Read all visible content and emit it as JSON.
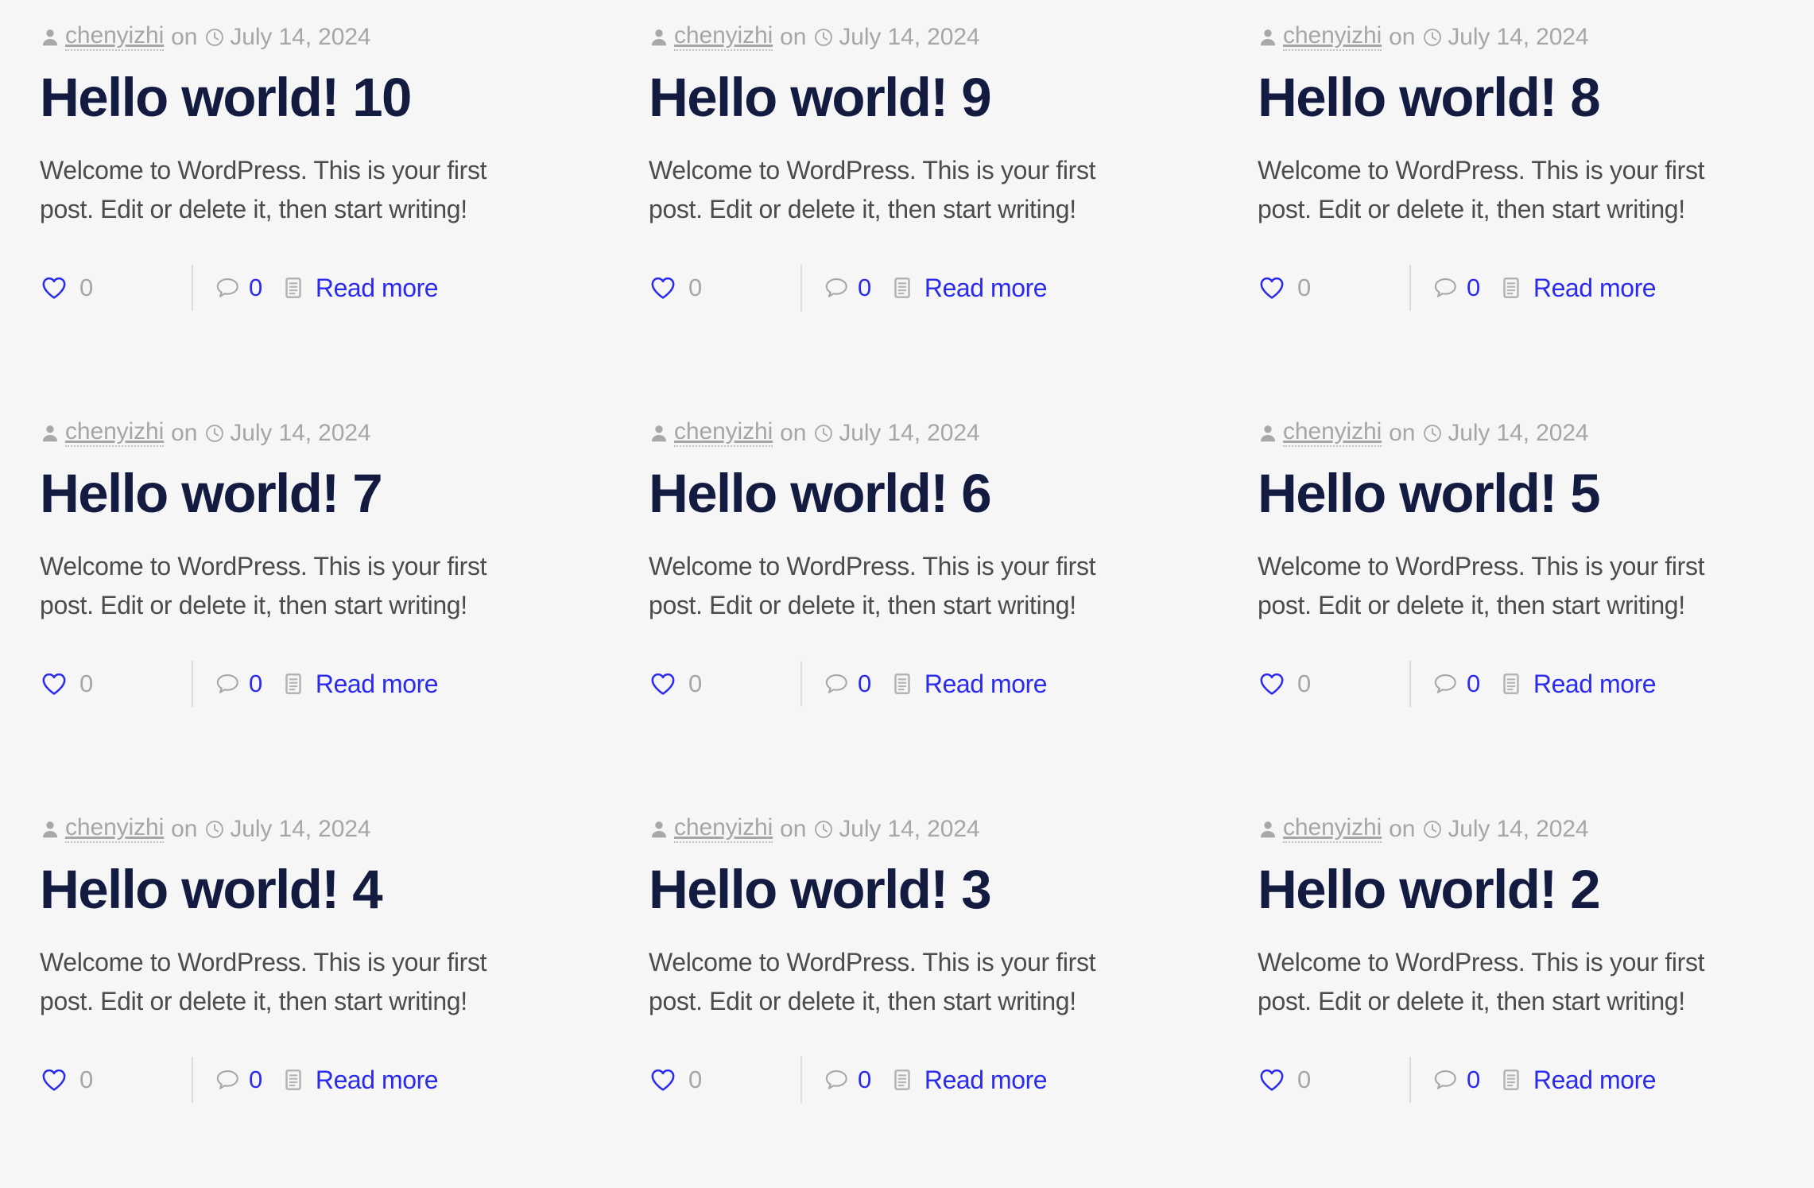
{
  "theme": {
    "background": "#f6f6f7",
    "title_color": "#141b41",
    "excerpt_color": "#4c4c4c",
    "meta_color": "#a6a6a6",
    "link_color": "#2b2bee",
    "divider_color": "#dcdcdc"
  },
  "labels": {
    "on": "on",
    "read_more": "Read more"
  },
  "icons": {
    "author": "user-icon",
    "date": "clock-icon",
    "likes": "heart-icon",
    "comments": "comment-bubble-icon",
    "read_more": "document-list-icon"
  },
  "posts": [
    {
      "author": "chenyizhi",
      "date": "July 14, 2024",
      "title": "Hello world! 10",
      "excerpt": "Welcome to WordPress. This is your first post. Edit or delete it, then start writing!",
      "likes": "0",
      "comments": "0",
      "read_more": "Read more"
    },
    {
      "author": "chenyizhi",
      "date": "July 14, 2024",
      "title": "Hello world! 9",
      "excerpt": "Welcome to WordPress. This is your first post. Edit or delete it, then start writing!",
      "likes": "0",
      "comments": "0",
      "read_more": "Read more"
    },
    {
      "author": "chenyizhi",
      "date": "July 14, 2024",
      "title": "Hello world! 8",
      "excerpt": "Welcome to WordPress. This is your first post. Edit or delete it, then start writing!",
      "likes": "0",
      "comments": "0",
      "read_more": "Read more"
    },
    {
      "author": "chenyizhi",
      "date": "July 14, 2024",
      "title": "Hello world! 7",
      "excerpt": "Welcome to WordPress. This is your first post. Edit or delete it, then start writing!",
      "likes": "0",
      "comments": "0",
      "read_more": "Read more"
    },
    {
      "author": "chenyizhi",
      "date": "July 14, 2024",
      "title": "Hello world! 6",
      "excerpt": "Welcome to WordPress. This is your first post. Edit or delete it, then start writing!",
      "likes": "0",
      "comments": "0",
      "read_more": "Read more"
    },
    {
      "author": "chenyizhi",
      "date": "July 14, 2024",
      "title": "Hello world! 5",
      "excerpt": "Welcome to WordPress. This is your first post. Edit or delete it, then start writing!",
      "likes": "0",
      "comments": "0",
      "read_more": "Read more"
    },
    {
      "author": "chenyizhi",
      "date": "July 14, 2024",
      "title": "Hello world! 4",
      "excerpt": "Welcome to WordPress. This is your first post. Edit or delete it, then start writing!",
      "likes": "0",
      "comments": "0",
      "read_more": "Read more"
    },
    {
      "author": "chenyizhi",
      "date": "July 14, 2024",
      "title": "Hello world! 3",
      "excerpt": "Welcome to WordPress. This is your first post. Edit or delete it, then start writing!",
      "likes": "0",
      "comments": "0",
      "read_more": "Read more"
    },
    {
      "author": "chenyizhi",
      "date": "July 14, 2024",
      "title": "Hello world! 2",
      "excerpt": "Welcome to WordPress. This is your first post. Edit or delete it, then start writing!",
      "likes": "0",
      "comments": "0",
      "read_more": "Read more"
    }
  ]
}
